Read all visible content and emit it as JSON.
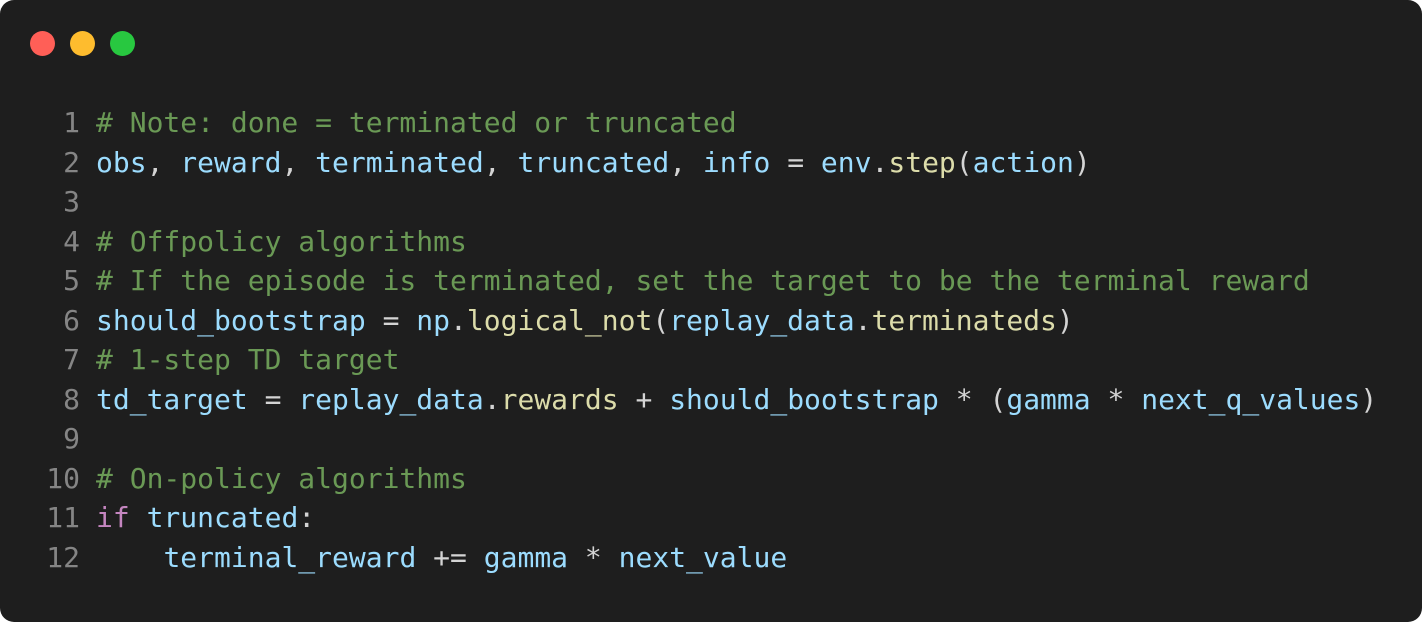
{
  "window": {
    "controls": [
      {
        "name": "close-dot",
        "color": "#ff5f57"
      },
      {
        "name": "minimize-dot",
        "color": "#febc2e"
      },
      {
        "name": "zoom-dot",
        "color": "#28c840"
      }
    ]
  },
  "colors": {
    "background": "#1e1e1e",
    "comment": "#6a9955",
    "variable": "#9cdcfe",
    "function": "#dcdcaa",
    "keyword": "#c586c0",
    "operator": "#d4d4d4",
    "line_number": "#858585"
  },
  "code": {
    "lines": [
      {
        "number": "1",
        "tokens": [
          {
            "t": "comment",
            "v": "# Note: done = terminated or truncated"
          }
        ]
      },
      {
        "number": "2",
        "tokens": [
          {
            "t": "var",
            "v": "obs"
          },
          {
            "t": "op",
            "v": ", "
          },
          {
            "t": "var",
            "v": "reward"
          },
          {
            "t": "op",
            "v": ", "
          },
          {
            "t": "var",
            "v": "terminated"
          },
          {
            "t": "op",
            "v": ", "
          },
          {
            "t": "var",
            "v": "truncated"
          },
          {
            "t": "op",
            "v": ", "
          },
          {
            "t": "var",
            "v": "info"
          },
          {
            "t": "op",
            "v": " = "
          },
          {
            "t": "var",
            "v": "env"
          },
          {
            "t": "op",
            "v": "."
          },
          {
            "t": "fn",
            "v": "step"
          },
          {
            "t": "op",
            "v": "("
          },
          {
            "t": "var",
            "v": "action"
          },
          {
            "t": "op",
            "v": ")"
          }
        ]
      },
      {
        "number": "3",
        "tokens": []
      },
      {
        "number": "4",
        "tokens": [
          {
            "t": "comment",
            "v": "# Offpolicy algorithms"
          }
        ]
      },
      {
        "number": "5",
        "tokens": [
          {
            "t": "comment",
            "v": "# If the episode is terminated, set the target to be the terminal reward"
          }
        ]
      },
      {
        "number": "6",
        "tokens": [
          {
            "t": "var",
            "v": "should_bootstrap"
          },
          {
            "t": "op",
            "v": " = "
          },
          {
            "t": "var",
            "v": "np"
          },
          {
            "t": "op",
            "v": "."
          },
          {
            "t": "fn",
            "v": "logical_not"
          },
          {
            "t": "op",
            "v": "("
          },
          {
            "t": "var",
            "v": "replay_data"
          },
          {
            "t": "op",
            "v": "."
          },
          {
            "t": "fn",
            "v": "terminateds"
          },
          {
            "t": "op",
            "v": ")"
          }
        ]
      },
      {
        "number": "7",
        "tokens": [
          {
            "t": "comment",
            "v": "# 1-step TD target"
          }
        ]
      },
      {
        "number": "8",
        "tokens": [
          {
            "t": "var",
            "v": "td_target"
          },
          {
            "t": "op",
            "v": " = "
          },
          {
            "t": "var",
            "v": "replay_data"
          },
          {
            "t": "op",
            "v": "."
          },
          {
            "t": "fn",
            "v": "rewards"
          },
          {
            "t": "op",
            "v": " + "
          },
          {
            "t": "var",
            "v": "should_bootstrap"
          },
          {
            "t": "op",
            "v": " * ("
          },
          {
            "t": "var",
            "v": "gamma"
          },
          {
            "t": "op",
            "v": " * "
          },
          {
            "t": "var",
            "v": "next_q_values"
          },
          {
            "t": "op",
            "v": ")"
          }
        ]
      },
      {
        "number": "9",
        "tokens": []
      },
      {
        "number": "10",
        "tokens": [
          {
            "t": "comment",
            "v": "# On-policy algorithms"
          }
        ]
      },
      {
        "number": "11",
        "tokens": [
          {
            "t": "kw",
            "v": "if"
          },
          {
            "t": "op",
            "v": " "
          },
          {
            "t": "var",
            "v": "truncated"
          },
          {
            "t": "op",
            "v": ":"
          }
        ]
      },
      {
        "number": "12",
        "tokens": [
          {
            "t": "op",
            "v": "    "
          },
          {
            "t": "var",
            "v": "terminal_reward"
          },
          {
            "t": "op",
            "v": " += "
          },
          {
            "t": "var",
            "v": "gamma"
          },
          {
            "t": "op",
            "v": " * "
          },
          {
            "t": "var",
            "v": "next_value"
          }
        ]
      }
    ]
  }
}
